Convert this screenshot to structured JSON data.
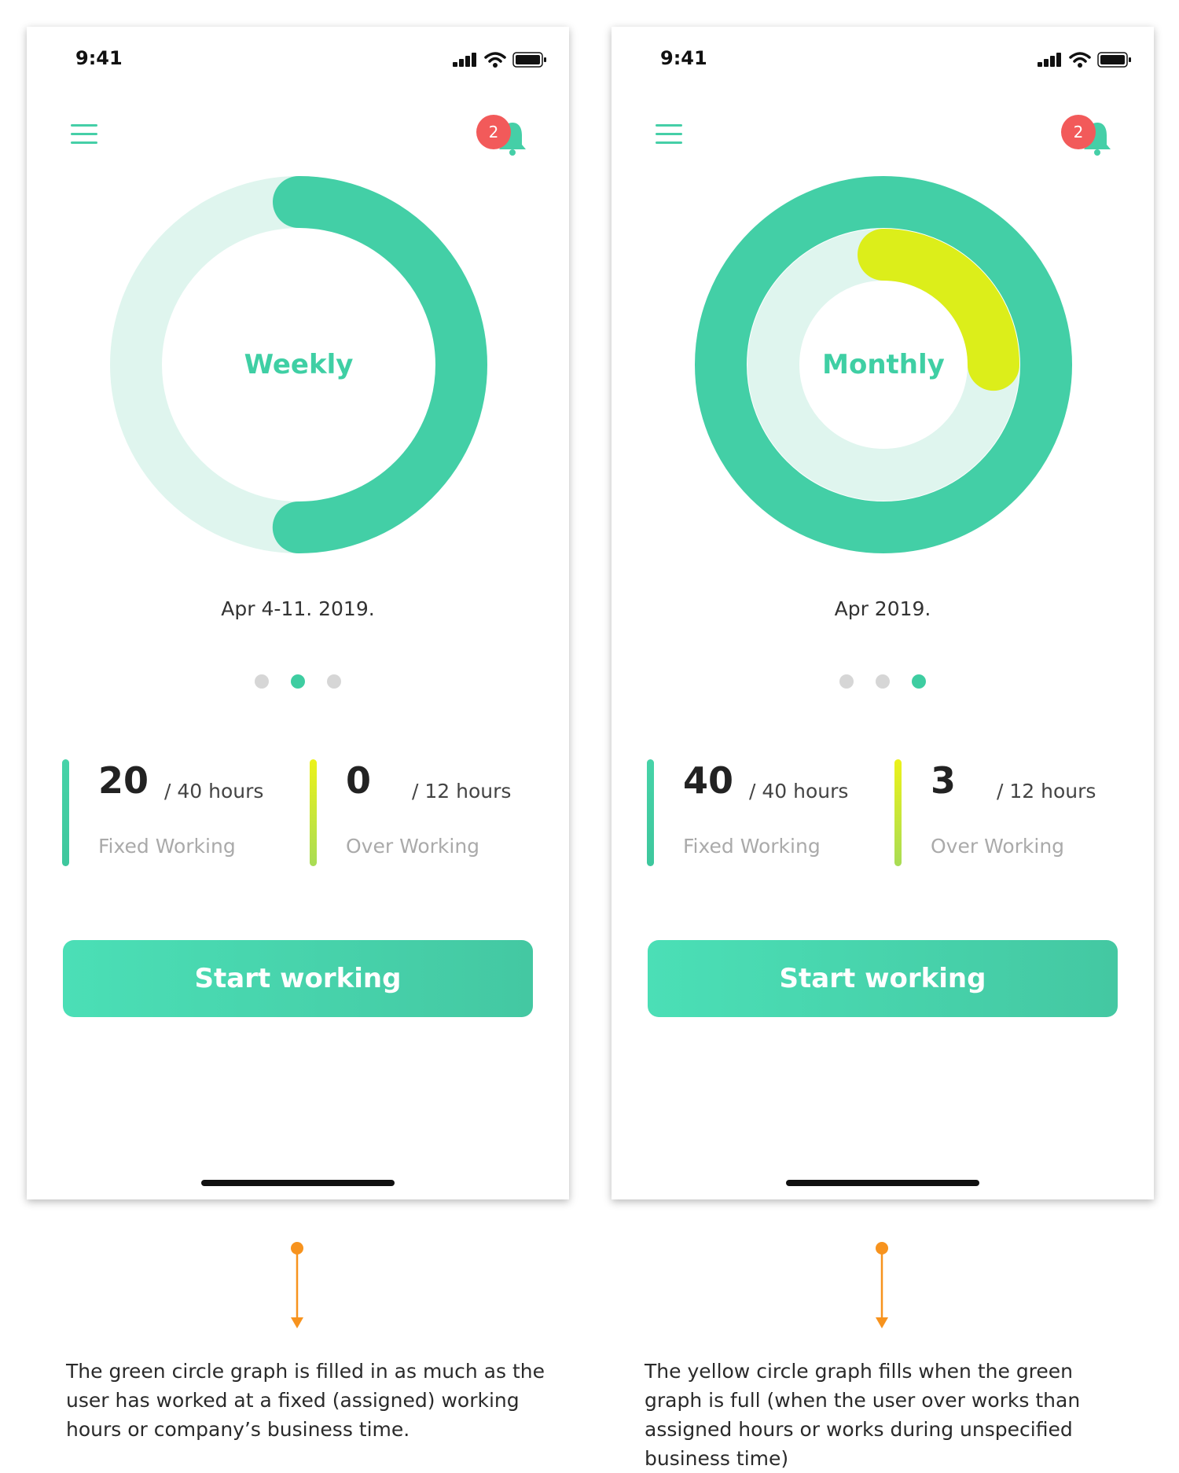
{
  "screens": [
    {
      "status_time": "9:41",
      "badge_count": "2",
      "period_label": "Weekly",
      "date": "Apr 4-11. 2019.",
      "active_page": 2,
      "fixed_ring_progress": 0.5,
      "over_ring_progress": 0,
      "fixed": {
        "value": "20",
        "total": "/ 40 hours",
        "label": "Fixed Working"
      },
      "over": {
        "value": "0",
        "total": "/ 12 hours",
        "label": "Over Working"
      },
      "button_label": "Start working",
      "caption": "The green circle graph is filled in as much as the user has worked at a fixed (assigned) working hours or company’s business time."
    },
    {
      "status_time": "9:41",
      "badge_count": "2",
      "period_label": "Monthly",
      "date": "Apr 2019.",
      "active_page": 3,
      "fixed_ring_progress": 1,
      "over_ring_progress": 0.25,
      "fixed": {
        "value": "40",
        "total": "/ 40 hours",
        "label": "Fixed Working"
      },
      "over": {
        "value": "3",
        "total": "/ 12 hours",
        "label": "Over Working"
      },
      "button_label": "Start working",
      "caption": "The yellow circle graph fills when the green graph is full (when the user over works than assigned hours or works during unspecified business time)"
    }
  ],
  "colors": {
    "green": "#43cfa6",
    "green_light": "#dff5ee",
    "yellow": "#dcee1a",
    "badge": "#f25a5a",
    "arrow": "#f7931e"
  },
  "icons": [
    "menu-icon",
    "bell-icon",
    "signal-icon",
    "wifi-icon",
    "battery-icon",
    "arrow-down-icon"
  ]
}
